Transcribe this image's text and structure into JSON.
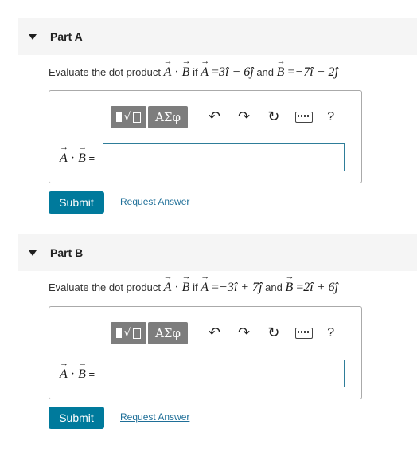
{
  "parts": [
    {
      "title": "Part A",
      "question_prefix": "Evaluate the dot product",
      "q_if": "if",
      "q_and": "and",
      "A_expr": "3î − 6ĵ",
      "B_expr": "−7î − 2ĵ",
      "answer_label": "=",
      "answer_value": "",
      "toolbar": {
        "symbols_label": "ΑΣφ",
        "help_label": "?"
      },
      "submit_label": "Submit",
      "request_label": "Request Answer"
    },
    {
      "title": "Part B",
      "question_prefix": "Evaluate the dot product",
      "q_if": "if",
      "q_and": "and",
      "A_expr": "−3î + 7ĵ",
      "B_expr": "2î + 6ĵ",
      "answer_label": "=",
      "answer_value": "",
      "toolbar": {
        "symbols_label": "ΑΣφ",
        "help_label": "?"
      },
      "submit_label": "Submit",
      "request_label": "Request Answer"
    }
  ]
}
